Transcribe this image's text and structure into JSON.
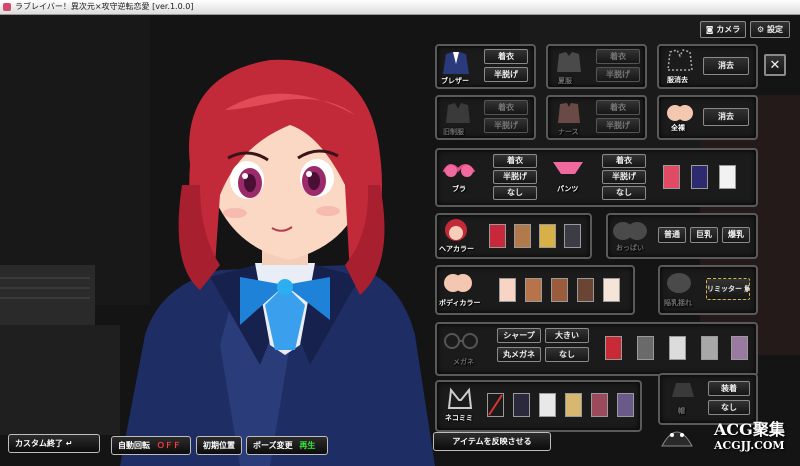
{
  "window": {
    "title": "ラブレイバー！異次元×攻守逆転恋愛 [ver.1.0.0]"
  },
  "top_buttons": {
    "camera": "カメラ",
    "settings": "設定",
    "close": "✕"
  },
  "outfit_row1": [
    {
      "name": "ブレザー",
      "dim": false,
      "buttons": [
        "着衣",
        "半脱げ"
      ]
    },
    {
      "name": "夏服",
      "dim": true,
      "buttons": [
        "着衣",
        "半脱げ"
      ]
    },
    {
      "name": "服消去",
      "dim": false,
      "buttons": [
        "消去"
      ]
    }
  ],
  "outfit_row2": [
    {
      "name": "旧制服",
      "dim": true,
      "buttons": [
        "着衣",
        "半脱げ"
      ]
    },
    {
      "name": "ナース",
      "dim": true,
      "buttons": [
        "着衣",
        "半脱げ"
      ]
    },
    {
      "name": "全裸",
      "dim": false,
      "buttons": [
        "消去"
      ]
    }
  ],
  "underwear": {
    "bra": {
      "name": "ブラ",
      "buttons": [
        "着衣",
        "半脱げ",
        "なし"
      ]
    },
    "panties": {
      "name": "パンツ",
      "buttons": [
        "着衣",
        "半脱げ",
        "なし"
      ]
    },
    "swatches": [
      "#e04a64",
      "#2d2a6f",
      "#f2f2f2"
    ]
  },
  "hair": {
    "name": "ヘアカラー",
    "swatches": [
      "#c8283c",
      "#b07a4a",
      "#d8b048",
      "#3c3c46"
    ]
  },
  "bust": {
    "name": "おっぱい",
    "buttons": [
      "普通",
      "巨乳",
      "爆乳"
    ]
  },
  "body": {
    "name": "ボディカラー",
    "swatches": [
      "#f8d4c4",
      "#b8734a",
      "#9a5c3c",
      "#6a4534",
      "#f6e4d8"
    ]
  },
  "nipple": {
    "name": "陥乳揺れ",
    "buttons": [
      "リミッター 解除"
    ]
  },
  "glasses": {
    "name": "メガネ",
    "buttons": [
      "シャープ",
      "大きい",
      "丸メガネ",
      "なし"
    ],
    "swatches": [
      "#c82a36",
      "#6a6a6a",
      "#dcdcdc",
      "#a8a8a8",
      "#9a7aa0"
    ]
  },
  "ears": {
    "name": "ネコミミ",
    "swatches": [
      "none",
      "#2a2a3c",
      "#e8e8e8",
      "#d8b870",
      "#9a4a5a",
      "#6a5a8a"
    ]
  },
  "accessory": {
    "name": "帽",
    "buttons": [
      "装着",
      "なし"
    ]
  },
  "bottom": {
    "custom_end": "カスタム終了",
    "auto_rotate": "自動回転",
    "auto_rotate_state": "ＯＦＦ",
    "initial_pos": "初期位置",
    "pose_change": "ポーズ変更",
    "pose_state": "再生",
    "apply": "アイテムを反映させる"
  },
  "watermark": {
    "text": "ACG聚集",
    "url": "ACGJJ.COM"
  },
  "colors": {
    "panel_border": "#5a5a5a",
    "state_off": "#ff3b3b",
    "state_play": "#39e639",
    "hair": "#c22a3a",
    "blazer": "#1e2d63"
  }
}
